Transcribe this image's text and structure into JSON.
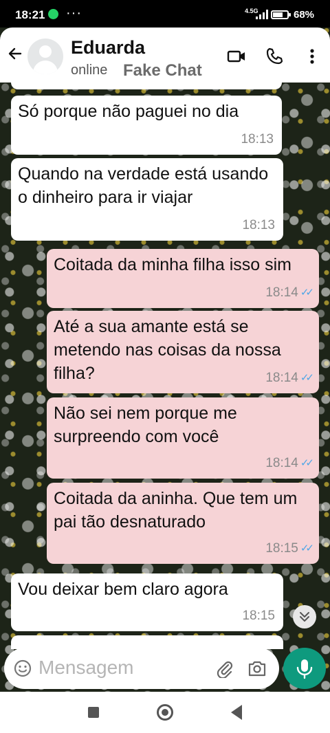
{
  "status_bar": {
    "time": "18:21",
    "notification_dots": "···",
    "network": "4.5G",
    "battery_percent_label": "68%",
    "battery_level": 0.68
  },
  "header": {
    "contact_name": "Eduarda",
    "contact_status": "online",
    "tag": "Fake Chat",
    "icons": [
      "back-arrow-icon",
      "video-call-icon",
      "voice-call-icon",
      "more-options-icon"
    ]
  },
  "messages": [
    {
      "text": "Só porque não paguei no dia",
      "time": "18:13",
      "direction": "in"
    },
    {
      "text": "Quando na verdade está usando o dinheiro para ir viajar",
      "time": "18:13",
      "direction": "in"
    },
    {
      "text": "Coitada da minha filha isso sim",
      "time": "18:14",
      "direction": "out"
    },
    {
      "text": "Até a sua amante está se metendo nas coisas da nossa filha?",
      "time": "18:14",
      "direction": "out"
    },
    {
      "text": "Não sei nem porque me surpreendo com você",
      "time": "18:14",
      "direction": "out"
    },
    {
      "text": "Coitada da aninha. Que tem um pai tão desnaturado",
      "time": "18:15",
      "direction": "out"
    },
    {
      "text": "Vou deixar bem claro agora",
      "time": "18:15",
      "direction": "in"
    }
  ],
  "composer": {
    "placeholder": "Mensagem"
  },
  "colors": {
    "incoming_bubble": "#ffffff",
    "outgoing_bubble": "#f6d3d6",
    "read_ticks": "#4fa6e6",
    "mic_button": "#0e9a7e"
  }
}
